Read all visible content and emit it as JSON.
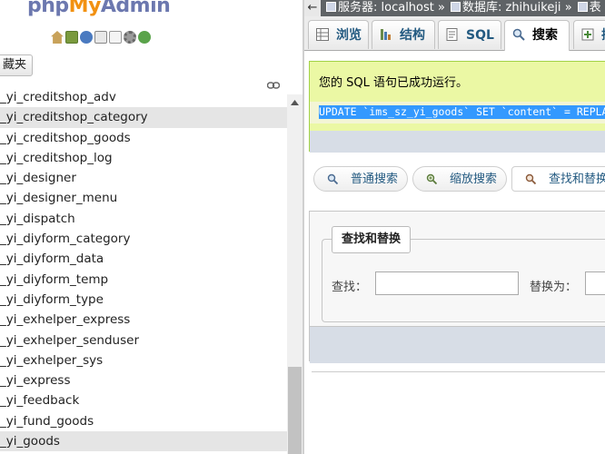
{
  "logo": {
    "php": "php",
    "my": "My",
    "admin": "Admin"
  },
  "nav_icons": [
    "home-icon",
    "exit-icon",
    "help-icon",
    "docs-icon",
    "copy-icon",
    "settings-icon",
    "reload-icon"
  ],
  "favorites_button": "藏夹",
  "tables": [
    "_yi_creditshop_adv",
    "_yi_creditshop_category",
    "_yi_creditshop_goods",
    "_yi_creditshop_log",
    "_yi_designer",
    "_yi_designer_menu",
    "_yi_dispatch",
    "_yi_diyform_category",
    "_yi_diyform_data",
    "_yi_diyform_temp",
    "_yi_diyform_type",
    "_yi_exhelper_express",
    "_yi_exhelper_senduser",
    "_yi_exhelper_sys",
    "_yi_express",
    "_yi_feedback",
    "_yi_fund_goods",
    "_yi_goods"
  ],
  "breadcrumb": {
    "server_label": "服务器: localhost",
    "sep1": "»",
    "db_label": "数据库: zhihuikeji",
    "sep2": "»",
    "table_label": "表"
  },
  "tabs": [
    {
      "label": "浏览",
      "icon": "browse-icon"
    },
    {
      "label": "结构",
      "icon": "structure-icon"
    },
    {
      "label": "SQL",
      "icon": "sql-icon"
    },
    {
      "label": "搜索",
      "icon": "search-icon"
    },
    {
      "label": "插",
      "icon": "insert-icon"
    }
  ],
  "success": {
    "message": "您的 SQL 语句已成功运行。",
    "sql": "UPDATE `ims_sz_yi_goods` SET `content` = REPLA"
  },
  "search_buttons": [
    {
      "label": "普通搜索",
      "icon": "search-icon"
    },
    {
      "label": "缩放搜索",
      "icon": "zoom-search-icon"
    },
    {
      "label": "查找和替换",
      "icon": "find-replace-icon"
    }
  ],
  "find_replace": {
    "legend": "查找和替换",
    "find_label": "查找：",
    "find_value": "",
    "replace_label": "替换为：",
    "replace_value": ""
  },
  "colors": {
    "brand_blue": "#6c78af",
    "brand_orange": "#f29111",
    "link_blue": "#235a81",
    "success_bg": "#ebf8a4",
    "selection_blue": "#3399ff"
  }
}
